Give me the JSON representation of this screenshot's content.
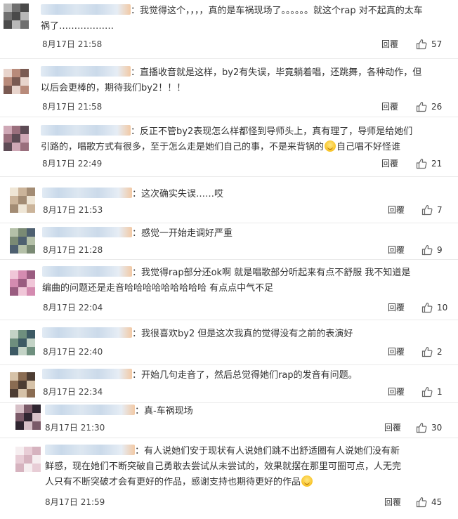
{
  "comments": [
    {
      "text": "我觉得这个，，，，真的是车祸现场了。。。。。。就这个rap 对不起真的太车祸了………………",
      "emoji": false,
      "time": "8月17日 21:58",
      "reply": "回覆",
      "likes": "57"
    },
    {
      "text": "直播收音就是这样，by2有失误，毕竟躺着唱，还跳舞，各种动作，但以后会更棒的，期待我们by2！！！",
      "emoji": false,
      "time": "8月17日 21:58",
      "reply": "回覆",
      "likes": "26"
    },
    {
      "text": "反正不管by2表现怎么样都怪到导师头上，真有理了，导师是给她们引路的，唱歌方式有很多，至于怎么走是她们自己的事，不是来背锅的",
      "text_after": "自己唱不好怪谁",
      "emoji": true,
      "time": "8月17日 22:49",
      "reply": "回覆",
      "likes": "21"
    },
    {
      "text": "这次确实失误……哎",
      "emoji": false,
      "time": "8月17日 21:53",
      "reply": "回覆",
      "likes": "7"
    },
    {
      "text": "感觉一开始走调好严重",
      "emoji": false,
      "time": "8月17日 21:28",
      "reply": "回覆",
      "likes": "9"
    },
    {
      "text": "我觉得rap部分还ok啊 就是唱歌部分听起来有点不舒服 我不知道是编曲的问题还是走音哈哈哈哈哈哈哈哈哈 有点点中气不足",
      "emoji": false,
      "time": "8月17日 22:04",
      "reply": "回覆",
      "likes": "10"
    },
    {
      "text": "我很喜欢by2 但是这次我真的觉得没有之前的表演好",
      "emoji": false,
      "time": "8月17日 22:40",
      "reply": "回覆",
      "likes": "2"
    },
    {
      "text": "开始几句走音了，然后总觉得她们rap的发音有问题。",
      "emoji": false,
      "time": "8月17日 22:34",
      "reply": "回覆",
      "likes": "1"
    },
    {
      "text": "真-车祸现场",
      "emoji": false,
      "time": "8月17日 21:30",
      "reply": "回覆",
      "likes": "30"
    },
    {
      "text": "有人说她们安于现状有人说她们跳不出舒适圈有人说她们没有新鲜感，现在她们不断突破自己勇敢去尝试从未尝试的，效果就摆在那里可圈可点，人无完人只有不断突破才会有更好的作品，感谢支持也期待更好的作品",
      "text_after": "",
      "emoji": true,
      "time": "8月17日 21:59",
      "reply": "回覆",
      "likes": "45"
    }
  ],
  "colors": {
    "text": "#333333",
    "border": "#eaeaea",
    "icon": "#666666"
  },
  "icons": {
    "like": "thumbs-up-icon"
  }
}
